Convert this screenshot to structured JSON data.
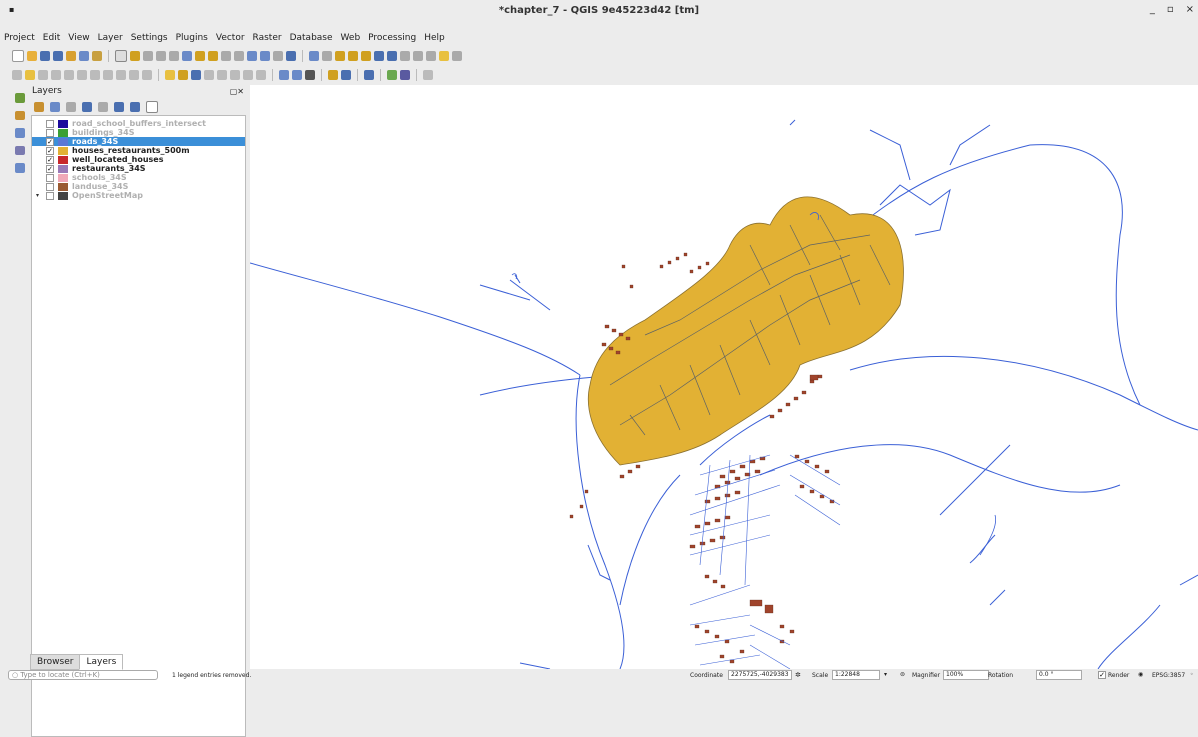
{
  "window": {
    "title": "*chapter_7 - QGIS 9e45223d42 [tm]",
    "icon": "qgis-app-icon",
    "controls": [
      "_",
      "▫",
      "×"
    ]
  },
  "menubar": {
    "items": [
      "Project",
      "Edit",
      "View",
      "Layer",
      "Settings",
      "Plugins",
      "Vector",
      "Raster",
      "Database",
      "Web",
      "Processing",
      "Help"
    ]
  },
  "layers_panel": {
    "title": "Layers",
    "layers": [
      {
        "name": "road_school_buffers_intersect",
        "checked": false,
        "color": "#1c0b9c",
        "selected": false,
        "dim": true
      },
      {
        "name": "buildings_34S",
        "checked": false,
        "color": "#3aa034",
        "selected": false,
        "dim": true
      },
      {
        "name": "roads_34S",
        "checked": true,
        "color": "#5a78d6",
        "selected": true,
        "dim": false
      },
      {
        "name": "houses_restaurants_500m",
        "checked": true,
        "color": "#e2b134",
        "selected": false,
        "dim": false
      },
      {
        "name": "well_located_houses",
        "checked": true,
        "color": "#c8282c",
        "selected": false,
        "dim": false
      },
      {
        "name": "restaurants_34S",
        "checked": true,
        "color": "#9a7ab8",
        "selected": false,
        "dim": false
      },
      {
        "name": "schools_34S",
        "checked": false,
        "color": "#f0a8b8",
        "selected": false,
        "dim": true
      },
      {
        "name": "landuse_34S",
        "checked": false,
        "color": "#9a5a32",
        "selected": false,
        "dim": true
      },
      {
        "name": "OpenStreetMap",
        "checked": false,
        "color": "#444444",
        "selected": false,
        "dim": true
      }
    ]
  },
  "tabs": {
    "browser": "Browser",
    "layers": "Layers"
  },
  "status": {
    "locate_placeholder": "Type to locate (Ctrl+K)",
    "message": "1 legend entries removed.",
    "coordinate_label": "Coordinate",
    "coordinate_value": "2275725,-4029383",
    "scale_label": "Scale",
    "scale_value": "1:22848",
    "magnifier_label": "Magnifier",
    "magnifier_value": "100%",
    "rotation_label": "Rotation",
    "rotation_value": "0.0 °",
    "render_label": "Render",
    "crs": "EPSG:3857"
  },
  "colors": {
    "buffer_fill": "#e2b134",
    "buffer_stroke": "#8a7030",
    "roads": "#3a5fd6",
    "buildings": "#a0442c",
    "selection": "#3b8fd8"
  }
}
